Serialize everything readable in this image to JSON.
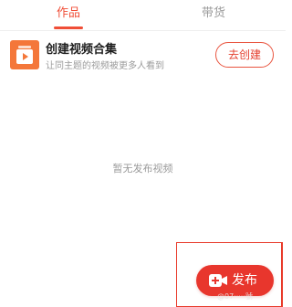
{
  "tabs": [
    {
      "label": "作品",
      "active": true
    },
    {
      "label": "带货",
      "active": false
    }
  ],
  "collection_card": {
    "title": "创建视频合集",
    "subtitle": "让同主题的视频被更多人看到",
    "button_label": "去创建",
    "icon": "video-collection-icon"
  },
  "empty_state": {
    "text": "暂无发布视频"
  },
  "publish": {
    "label": "发布",
    "icon": "video-add-icon"
  },
  "watermark": "@07·····號",
  "colors": {
    "accent": "#f04e37",
    "publish_bg": "#e8362d",
    "thumb_bg": "#f4773a"
  }
}
